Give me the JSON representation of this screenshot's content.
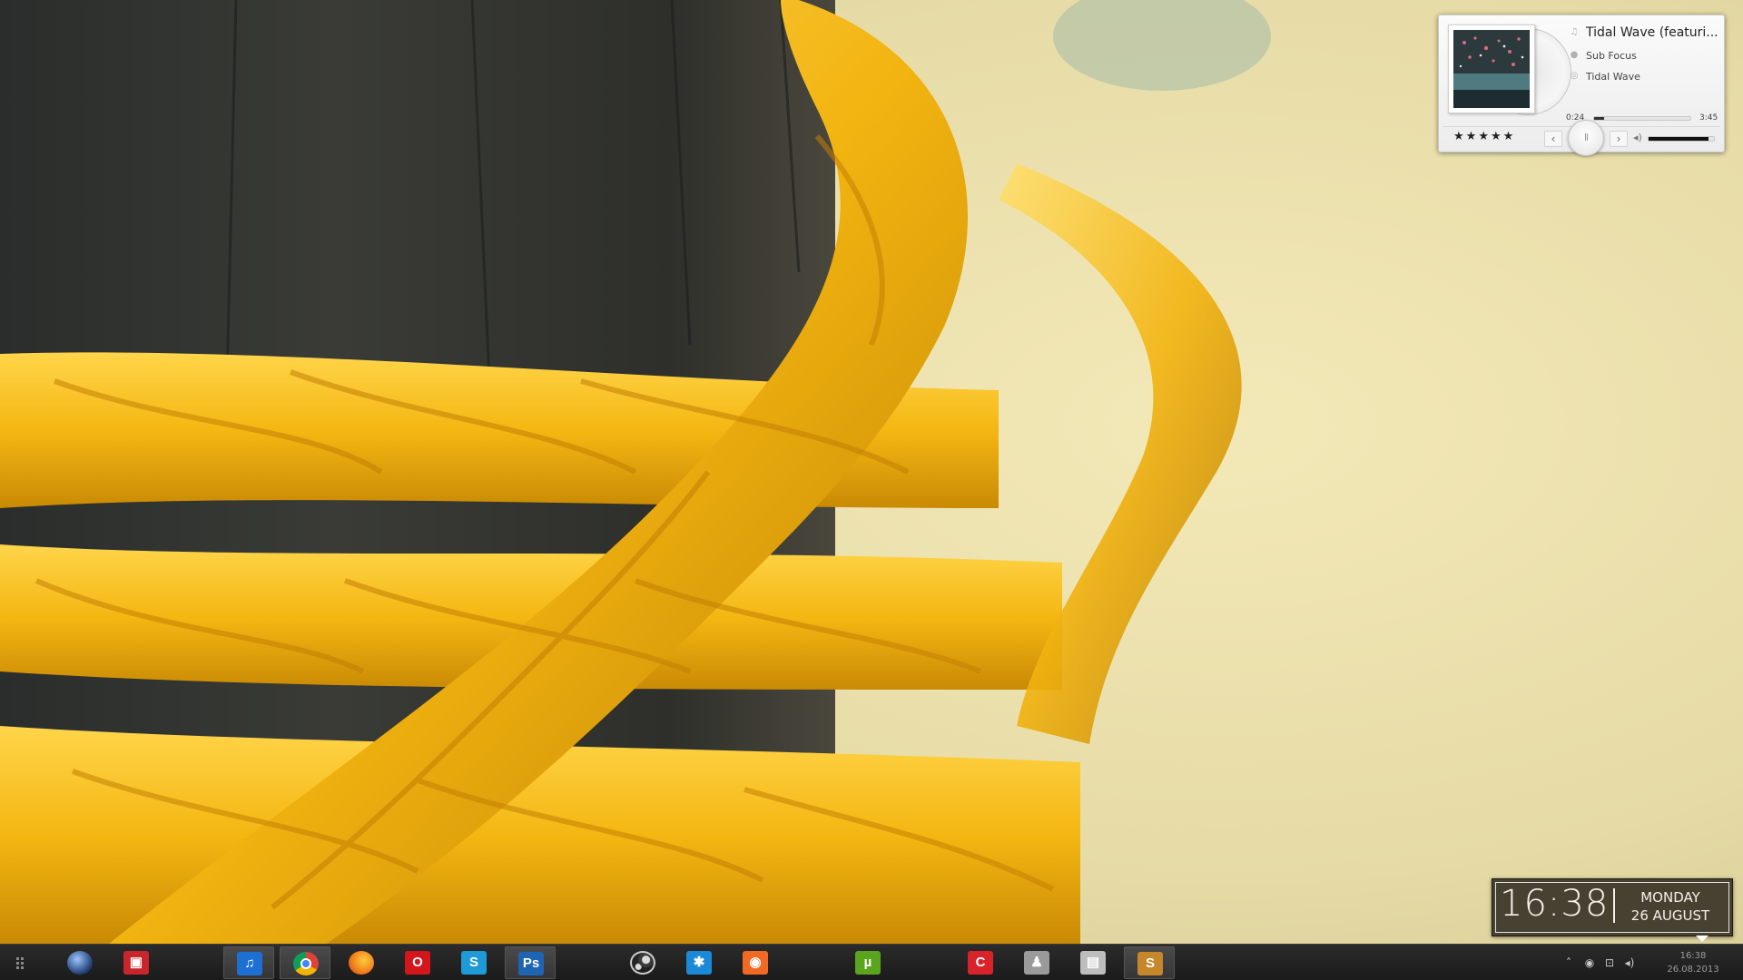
{
  "player": {
    "title": "Tidal Wave (featuri...",
    "artist": "Sub Focus",
    "album": "Tidal Wave",
    "elapsed": "0:24",
    "duration": "3:45",
    "progress_fraction": 0.107,
    "volume_fraction": 0.92,
    "rating": [
      "★",
      "★",
      "★",
      "★",
      "★"
    ],
    "prev_label": "‹",
    "next_label": "›",
    "play_label": "ll",
    "note_icon": "music-note-icon",
    "artist_icon": "person-icon",
    "album_icon": "disc-icon",
    "volume_icon": "speaker-icon"
  },
  "clock": {
    "time": "16:38",
    "day": "MONDAY",
    "date": "26 AUGUST"
  },
  "taskbar": {
    "apps": [
      {
        "name": "blue-orb-app",
        "glyph": "",
        "color": "#1f3c6e",
        "active": false
      },
      {
        "name": "video-app",
        "glyph": "▣",
        "color": "#c8262b",
        "active": false
      },
      {
        "name": "itunes-app",
        "glyph": "♫",
        "color": "#1d6fd1",
        "active": true
      },
      {
        "name": "chrome-app",
        "glyph": "",
        "color": "#e8e8e8",
        "active": true
      },
      {
        "name": "firefox-app",
        "glyph": "",
        "color": "#ef7a1a",
        "active": false
      },
      {
        "name": "opera-app",
        "glyph": "O",
        "color": "#d4151c",
        "active": false
      },
      {
        "name": "skype-app",
        "glyph": "S",
        "color": "#1e9ad6",
        "active": false
      },
      {
        "name": "photoshop-app",
        "glyph": "Ps",
        "color": "#1f63b3",
        "active": true
      },
      {
        "name": "steam-app",
        "glyph": "",
        "color": "#3a3a3a",
        "active": false
      },
      {
        "name": "puzzle-app",
        "glyph": "✱",
        "color": "#1a8ad8",
        "active": false
      },
      {
        "name": "media-app",
        "glyph": "◉",
        "color": "#f06a25",
        "active": false
      },
      {
        "name": "utorrent-app",
        "glyph": "µ",
        "color": "#5aa41e",
        "active": false
      },
      {
        "name": "ccleaner-app",
        "glyph": "C",
        "color": "#d9222a",
        "active": false
      },
      {
        "name": "user-app",
        "glyph": "♟",
        "color": "#9a9a9a",
        "active": false
      },
      {
        "name": "archive-app",
        "glyph": "▤",
        "color": "#bdbdbd",
        "active": false
      },
      {
        "name": "sublime-app",
        "glyph": "S",
        "color": "#c6862a",
        "active": true
      }
    ],
    "tray": {
      "expand": "˄",
      "time": "16:38",
      "date": "26.08.2013"
    }
  }
}
